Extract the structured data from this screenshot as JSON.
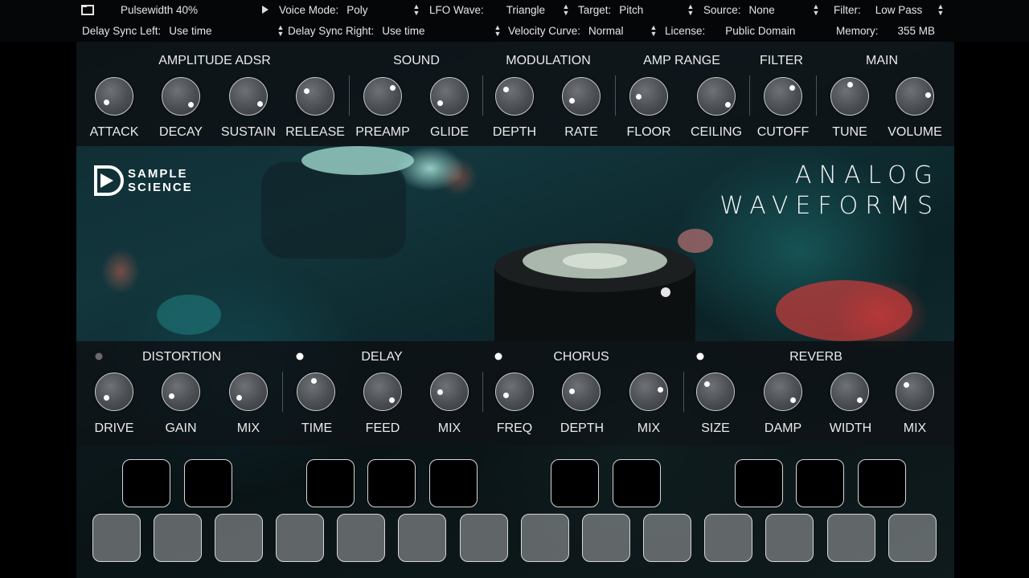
{
  "toolbar": {
    "preset": "Pulsewidth 40%",
    "row1": [
      {
        "key": "Voice Mode:",
        "value": "Poly"
      },
      {
        "key": "LFO Wave:",
        "value": "Triangle"
      },
      {
        "key": "Target:",
        "value": "Pitch"
      },
      {
        "key": "Source:",
        "value": "None"
      },
      {
        "key": "Filter:",
        "value": "Low Pass"
      }
    ],
    "row2": [
      {
        "key": "Delay Sync Left:",
        "value": "Use time"
      },
      {
        "key": "Delay Sync Right:",
        "value": "Use time"
      },
      {
        "key": "Velocity Curve:",
        "value": "Normal"
      },
      {
        "key": "License:",
        "value": "Public Domain"
      },
      {
        "key": "Memory:",
        "value": "355 MB"
      }
    ]
  },
  "top_sections": [
    {
      "title": "AMPLITUDE ADSR",
      "knobs": [
        "ATTACK",
        "DECAY",
        "SUSTAIN",
        "RELEASE"
      ]
    },
    {
      "title": "SOUND",
      "knobs": [
        "PREAMP",
        "GLIDE"
      ]
    },
    {
      "title": "MODULATION",
      "knobs": [
        "DEPTH",
        "RATE"
      ]
    },
    {
      "title": "AMP RANGE",
      "knobs": [
        "FLOOR",
        "CEILING"
      ]
    },
    {
      "title": "FILTER",
      "knobs": [
        "CUTOFF"
      ]
    },
    {
      "title": "MAIN",
      "knobs": [
        "TUNE",
        "VOLUME"
      ]
    }
  ],
  "bottom_sections": [
    {
      "title": "DISTORTION",
      "enabled": false,
      "knobs": [
        "DRIVE",
        "GAIN",
        "MIX"
      ]
    },
    {
      "title": "DELAY",
      "enabled": true,
      "knobs": [
        "TIME",
        "FEED",
        "MIX"
      ]
    },
    {
      "title": "CHORUS",
      "enabled": true,
      "knobs": [
        "FREQ",
        "DEPTH",
        "MIX"
      ]
    },
    {
      "title": "REVERB",
      "enabled": true,
      "knobs": [
        "SIZE",
        "DAMP",
        "WIDTH",
        "MIX"
      ]
    }
  ],
  "logo": {
    "line1": "SAMPLE",
    "line2": "SCIENCE"
  },
  "brand": {
    "line1": "ANALOG",
    "line2": "WAVEFORMS"
  },
  "colors": {
    "led_on": "#ffffff",
    "led_off": "#6a6a6a",
    "panel": "#0e1014"
  }
}
